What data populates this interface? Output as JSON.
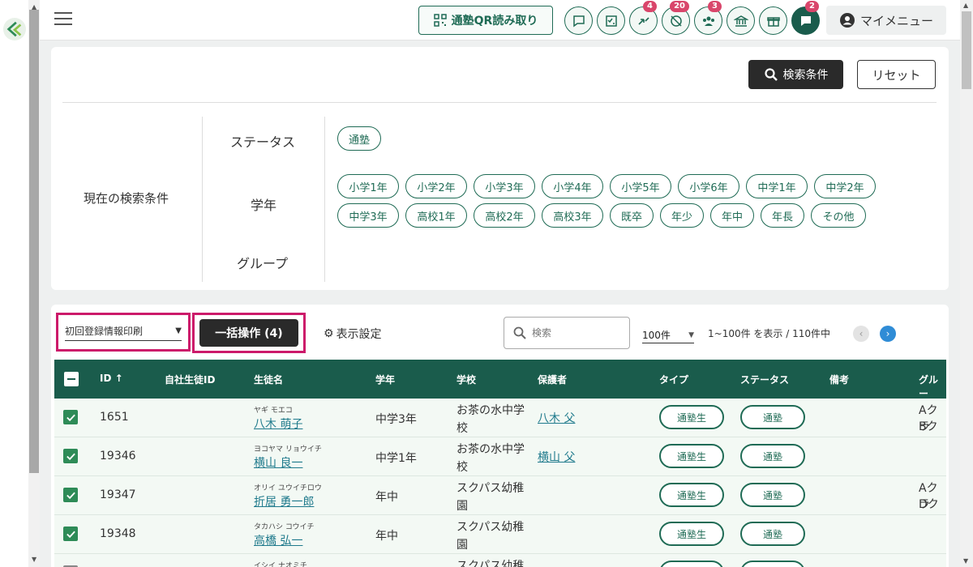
{
  "header": {
    "qr_label": "通塾QR読み取り",
    "badges": {
      "arrows": "4",
      "eye_off": "20",
      "group": "3",
      "chat": "2"
    },
    "mymenu_label": "マイメニュー"
  },
  "search": {
    "search_button": "検索条件",
    "reset_button": "リセット",
    "current_conditions_label": "現在の検索条件",
    "rows": {
      "status_label": "ステータス",
      "grade_label": "学年",
      "group_label": "グループ"
    },
    "status_chips": [
      "通塾"
    ],
    "grade_chips_row1": [
      "小学1年",
      "小学2年",
      "小学3年",
      "小学4年",
      "小学5年",
      "小学6年",
      "中学1年",
      "中学2年"
    ],
    "grade_chips_row2": [
      "中学3年",
      "高校1年",
      "高校2年",
      "高校3年",
      "既卒",
      "年少",
      "年中",
      "年長",
      "その他"
    ]
  },
  "list": {
    "print_select": "初回登録情報印刷",
    "bulk_button": "一括操作 (4)",
    "display_settings": "表示設定",
    "search_placeholder": "検索",
    "per_page": "100件",
    "range_text": "1~100件 を表示 / 110件中",
    "columns": [
      "ID ↑",
      "自社生徒ID",
      "生徒名",
      "学年",
      "学校",
      "保護者",
      "タイプ",
      "ステータス",
      "備考",
      "グルー"
    ],
    "rows": [
      {
        "id": "1651",
        "kana": "ヤギ モエコ",
        "name": "八木 萌子",
        "grade": "中学3年",
        "school1": "お茶の水中学",
        "school2": "校",
        "guardian": "八木 父",
        "type": "通塾生",
        "status": "通塾",
        "group1": "Aクラ",
        "group2": "Bクラ"
      },
      {
        "id": "19346",
        "kana": "ヨコヤマ リョウイチ",
        "name": "横山 良一",
        "grade": "中学1年",
        "school1": "お茶の水中学",
        "school2": "校",
        "guardian": "横山 父",
        "type": "通塾生",
        "status": "通塾",
        "group1": "",
        "group2": ""
      },
      {
        "id": "19347",
        "kana": "オリイ ユウイチロウ",
        "name": "折居 勇一郎",
        "grade": "年中",
        "school1": "スクパス幼稚",
        "school2": "園",
        "guardian": "",
        "type": "通塾生",
        "status": "通塾",
        "group1": "Aクラ",
        "group2": "Dクラ"
      },
      {
        "id": "19348",
        "kana": "タカハシ コウイチ",
        "name": "高橋 弘一",
        "grade": "年中",
        "school1": "スクパス幼稚",
        "school2": "園",
        "guardian": "",
        "type": "通塾生",
        "status": "通塾",
        "group1": "",
        "group2": ""
      },
      {
        "id": "",
        "kana": "イシイ ナオミチ",
        "name": "",
        "grade": "",
        "school1": "スクパス幼稚",
        "school2": "",
        "guardian": "",
        "type": "",
        "status": "",
        "group1": "",
        "group2": ""
      }
    ]
  },
  "colors": {
    "primary": "#1a5c4c",
    "highlight": "#cc1a6a",
    "badge": "#d9466b",
    "link": "#1f7a8c"
  }
}
